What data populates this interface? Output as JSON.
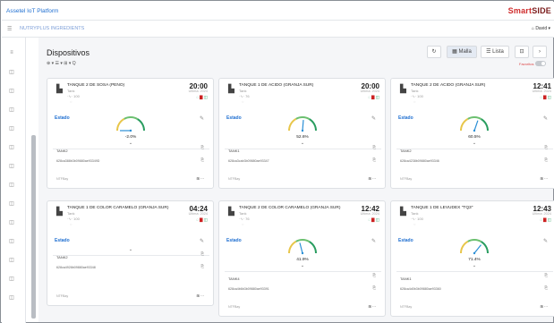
{
  "app": {
    "title": "Assetel IoT Platform",
    "brand_a": "Smart",
    "brand_b": "SIDE"
  },
  "subbar": {
    "menu_icon": "☰",
    "breadcrumb": "NUTRYPLUS INGREDIENTS",
    "user_icon": "home-icon",
    "user": "David ▾"
  },
  "sidebar": {
    "icons": [
      "≡",
      "◫",
      "◫",
      "◫",
      "◫",
      "◫",
      "◫",
      "◫",
      "◫",
      "◫",
      "◫",
      "◫",
      "◫",
      "◫"
    ]
  },
  "main": {
    "title": "Dispositivos",
    "filters": "⊕ ▾ ☰ ▾ ⊞ ▾ Q",
    "views": {
      "refresh": "↻",
      "grid": "▦ Malla",
      "list": "☰ Lista",
      "extra1": "⊡",
      "extra2": "›"
    },
    "favoritos": "Favoritos"
  },
  "cards": [
    {
      "name": "TANQUE 2 DE SOSA (PENO)",
      "type": "Tank",
      "time": "20:00",
      "date": "Ultima: 2024",
      "signal": "·∿· 100",
      "estado": "Estado",
      "value": "-2.0%",
      "level": 0.0,
      "tag": "TANK2",
      "id": "628ca388b3b09880ae93349D",
      "foot": "NTFBay",
      "foot_r": "⊞ ···"
    },
    {
      "name": "TANQUE 1 DE ÁCIDO (GRANJA SUR)",
      "type": "Tank",
      "time": "20:00",
      "date": "Ultima: 2024",
      "signal": "·∿· 76",
      "estado": "Estado",
      "value": "52.6%",
      "level": 0.526,
      "tag": "TANK1",
      "id": "628ca3cab3b09880ae93347",
      "foot": "NTFBay",
      "foot_r": "⊞ ···"
    },
    {
      "name": "TANQUE 2 DE ÁCIDO (GRANJA SUR)",
      "type": "Tank",
      "time": "12:41",
      "date": "Ultima: 2024",
      "signal": "·∿· 100",
      "estado": "Estado",
      "value": "60.5%",
      "level": 0.605,
      "tag": "TANK2",
      "id": "628ca4238b09880ae93346",
      "foot": "NTFBay",
      "foot_r": "⊞ ···"
    },
    {
      "name": "TANQUE 1 DE COLOR CARAMELO (GRANJA SUR)",
      "type": "Tank",
      "time": "04:24",
      "date": "Ultima: 2024",
      "signal": "·∿· 100",
      "estado": "Estado",
      "value": "",
      "level": null,
      "tag": "TANK2",
      "id": "628ca4928b09880ae93348",
      "foot": "NTFBay",
      "foot_r": "⊞ ···"
    },
    {
      "name": "TANQUE 2 DE COLOR CARAMELO (GRANJA SUR)",
      "type": "Tank",
      "time": "12:42",
      "date": "Ultima: 2024",
      "signal": "·∿· 76",
      "estado": "Estado",
      "value": "41.9%",
      "level": 0.419,
      "tag": "TANK4",
      "id": "628ca4b6b3b09880ae93391",
      "foot": "NTFBay",
      "foot_r": "⊞ ···"
    },
    {
      "name": "TANQUE 1 DE LEVUDEX \"TQ3\"",
      "type": "Tank",
      "time": "12:43",
      "date": "Ultima: 2024",
      "signal": "·∿· 100",
      "estado": "Estado",
      "value": "71.4%",
      "level": 0.714,
      "tag": "TANK1",
      "id": "628ca4d0b3b09880ae93360",
      "foot": "NTFBay",
      "foot_r": "⊞ ···"
    }
  ],
  "colors": {
    "accent": "#1f6fd1",
    "gauge_low": "#e8c64a",
    "gauge_mid": "#6cc070",
    "gauge_high": "#2a9d60",
    "needle": "#2b8fd6"
  }
}
